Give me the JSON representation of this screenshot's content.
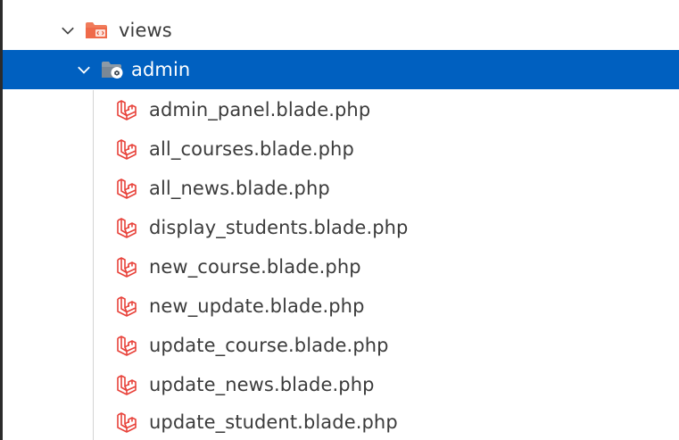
{
  "tree": {
    "views": {
      "label": "views",
      "icon": "views-folder-icon",
      "expanded": true
    },
    "admin": {
      "label": "admin",
      "icon": "admin-folder-icon",
      "expanded": true,
      "selected": true
    },
    "files": [
      {
        "label": "admin_panel.blade.php",
        "icon": "laravel-icon"
      },
      {
        "label": "all_courses.blade.php",
        "icon": "laravel-icon"
      },
      {
        "label": "all_news.blade.php",
        "icon": "laravel-icon"
      },
      {
        "label": "display_students.blade.php",
        "icon": "laravel-icon"
      },
      {
        "label": "new_course.blade.php",
        "icon": "laravel-icon"
      },
      {
        "label": "new_update.blade.php",
        "icon": "laravel-icon"
      },
      {
        "label": "update_course.blade.php",
        "icon": "laravel-icon"
      },
      {
        "label": "update_news.blade.php",
        "icon": "laravel-icon"
      },
      {
        "label": "update_student.blade.php",
        "icon": "laravel-icon"
      }
    ]
  },
  "colors": {
    "selection": "#0060c0",
    "laravel_red": "#e8423a",
    "text": "#3b3b3b"
  }
}
